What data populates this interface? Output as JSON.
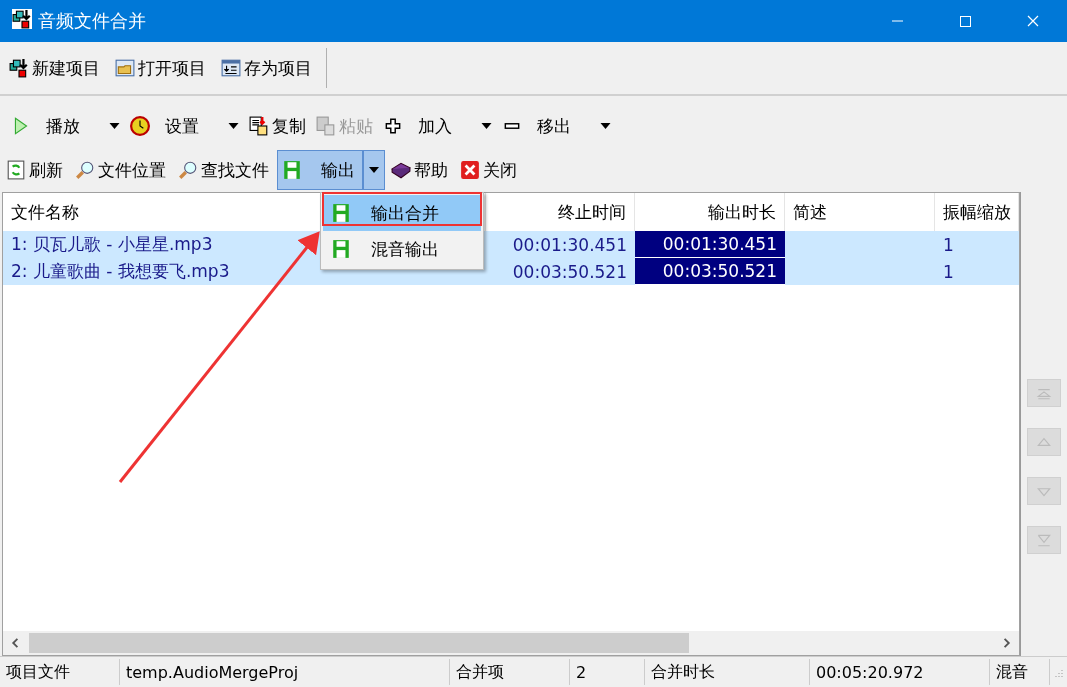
{
  "window": {
    "title": "音频文件合并"
  },
  "toolbar_1": [
    {
      "label": "新建项目"
    },
    {
      "label": "打开项目"
    },
    {
      "label": "存为项目"
    }
  ],
  "toolbar_2": [
    {
      "label": "播放",
      "dropdown": true,
      "disabled": false
    },
    {
      "label": "设置",
      "dropdown": true,
      "disabled": false
    },
    {
      "label": "复制",
      "dropdown": false,
      "disabled": false
    },
    {
      "label": "粘贴",
      "dropdown": false,
      "disabled": true
    },
    {
      "label": "加入",
      "dropdown": true,
      "disabled": false
    },
    {
      "label": "移出",
      "dropdown": true,
      "disabled": false
    }
  ],
  "toolbar_3": [
    {
      "label": "刷新",
      "pressed": false,
      "dropdown": false
    },
    {
      "label": "文件位置",
      "pressed": false,
      "dropdown": false
    },
    {
      "label": "查找文件",
      "pressed": false,
      "dropdown": false
    },
    {
      "label": "输出",
      "pressed": true,
      "dropdown": true
    },
    {
      "label": "帮助",
      "pressed": false,
      "dropdown": false
    },
    {
      "label": "关闭",
      "pressed": false,
      "dropdown": false
    }
  ],
  "dropdown_menu": {
    "items": [
      {
        "label": "输出合并",
        "selected": true
      },
      {
        "label": "混音输出",
        "selected": false
      }
    ]
  },
  "file_list": {
    "columns": [
      "文件名称",
      "终止时间",
      "输出时长",
      "简述",
      "振幅缩放"
    ],
    "rows": [
      {
        "name": "1: 贝瓦儿歌 - 小星星.mp3",
        "end_time": "00:01:30.451",
        "output_duration": "00:01:30.451",
        "amplitude_scale": "1",
        "selected": true
      },
      {
        "name": "2: 儿童歌曲 - 我想要飞.mp3",
        "end_time": "00:03:50.521",
        "output_duration": "00:03:50.521",
        "amplitude_scale": "1",
        "selected": true
      }
    ]
  },
  "status_bar": [
    {
      "text": "项目文件"
    },
    {
      "text": "temp.AudioMergeProj"
    },
    {
      "text": "合并项"
    },
    {
      "text": "2"
    },
    {
      "text": "合并时长"
    },
    {
      "text": "00:05:20.972"
    },
    {
      "text": "混音"
    }
  ]
}
